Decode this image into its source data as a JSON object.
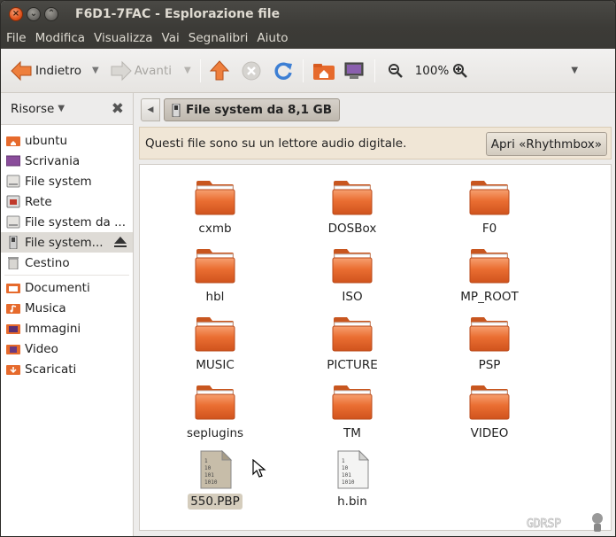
{
  "window": {
    "title": "F6D1-7FAC - Esplorazione file",
    "controls": {
      "close": "×",
      "minimize": "⌄",
      "maximize": "⌃"
    }
  },
  "menubar": {
    "items": [
      "File",
      "Modifica",
      "Visualizza",
      "Vai",
      "Segnalibri",
      "Aiuto"
    ]
  },
  "toolbar": {
    "back_label": "Indietro",
    "forward_label": "Avanti",
    "zoom_value": "100%"
  },
  "sidebar": {
    "title": "Risorse",
    "close_glyph": "✖",
    "items": [
      {
        "label": "ubuntu",
        "icon": "home-icon"
      },
      {
        "label": "Scrivania",
        "icon": "desktop-icon"
      },
      {
        "label": "File system",
        "icon": "harddisk-icon"
      },
      {
        "label": "Rete",
        "icon": "network-icon"
      },
      {
        "label": "File system da ...",
        "icon": "harddisk-icon"
      },
      {
        "label": "File system...",
        "icon": "usb-drive-icon",
        "selected": true
      },
      {
        "label": "Cestino",
        "icon": "trash-icon"
      },
      {
        "label": "Documenti",
        "icon": "folder-icon"
      },
      {
        "label": "Musica",
        "icon": "music-folder-icon"
      },
      {
        "label": "Immagini",
        "icon": "pictures-folder-icon"
      },
      {
        "label": "Video",
        "icon": "video-folder-icon"
      },
      {
        "label": "Scaricati",
        "icon": "downloads-folder-icon"
      }
    ]
  },
  "pathbar": {
    "back_glyph": "◀",
    "current": "File system da 8,1 GB"
  },
  "infobar": {
    "message": "Questi file sono su un lettore audio digitale.",
    "button_label": "Apri «Rhythmbox»"
  },
  "files": [
    {
      "name": "cxmb",
      "type": "folder"
    },
    {
      "name": "DOSBox",
      "type": "folder"
    },
    {
      "name": "F0",
      "type": "folder"
    },
    {
      "name": "hbl",
      "type": "folder"
    },
    {
      "name": "ISO",
      "type": "folder"
    },
    {
      "name": "MP_ROOT",
      "type": "folder"
    },
    {
      "name": "MUSIC",
      "type": "folder"
    },
    {
      "name": "PICTURE",
      "type": "folder"
    },
    {
      "name": "PSP",
      "type": "folder"
    },
    {
      "name": "seplugins",
      "type": "folder"
    },
    {
      "name": "TM",
      "type": "folder"
    },
    {
      "name": "VIDEO",
      "type": "folder"
    },
    {
      "name": "550.PBP",
      "type": "binary",
      "selected": true
    },
    {
      "name": "h.bin",
      "type": "binary"
    }
  ],
  "colors": {
    "titlebar": "#3c3b37",
    "folder_orange": "#e8692a",
    "selection": "#d5cdbd"
  }
}
